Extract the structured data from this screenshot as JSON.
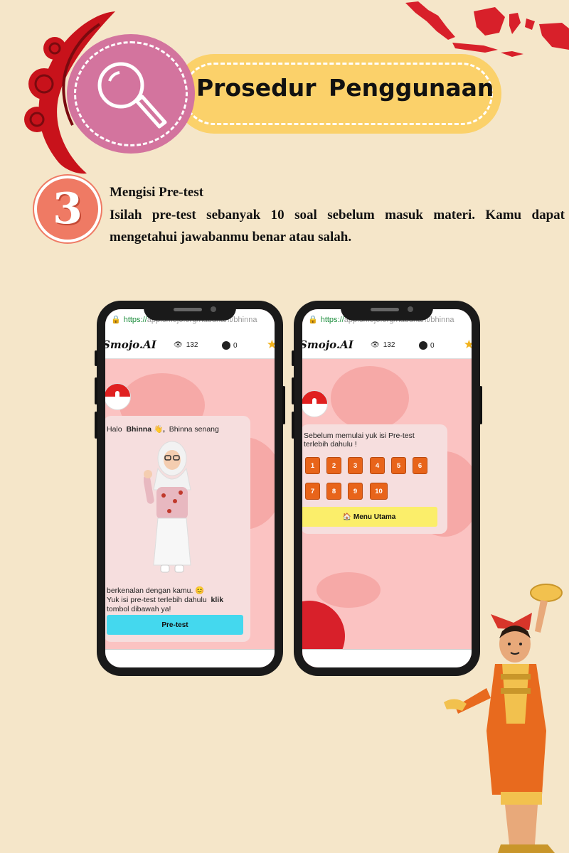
{
  "header": {
    "title": "Prosedur  Penggunaan",
    "icon": "magnifier-icon"
  },
  "step": {
    "number": "3",
    "title": "Mengisi Pre-test",
    "description": "Isilah pre-test sebanyak 10 soal sebelum masuk materi. Kamu dapat mengetahui jawabanmu benar atau salah."
  },
  "phone1": {
    "url_scheme": "https://",
    "url_rest": "app.smojo.org/habdhant/bhinna",
    "brand": "Smojo.AI",
    "views": "132",
    "comments": "0",
    "greeting_prefix": "Halo",
    "greeting_name": "Bhinna 👋,",
    "greeting_suffix": "Bhinna senang",
    "intro_line1": "berkenalan dengan kamu. 😊",
    "intro_line2": "Yuk isi pre-test terlebih dahulu",
    "intro_klik": "klik",
    "intro_line3": "tombol dibawah ya!",
    "button": "Pre-test"
  },
  "phone2": {
    "url_scheme": "https://",
    "url_rest": "app.smojo.org/habdhant/bhinna",
    "brand": "Smojo.AI",
    "views": "132",
    "comments": "0",
    "prompt_line1": "Sebelum memulai yuk isi Pre-test",
    "prompt_line2": "terlebih dahulu !",
    "numbers": [
      "1",
      "2",
      "3",
      "4",
      "5",
      "6",
      "7",
      "8",
      "9",
      "10"
    ],
    "menu_button": "🏠 Menu Utama"
  },
  "colors": {
    "background": "#f5e6c9",
    "title_pill": "#fbd16a",
    "circle": "#d3749e",
    "step_badge": "#ef7a64",
    "screen": "#fbc3c2",
    "pretest_button": "#44d8ee",
    "number_button": "#e8641a",
    "menu_button": "#fbee6a"
  }
}
